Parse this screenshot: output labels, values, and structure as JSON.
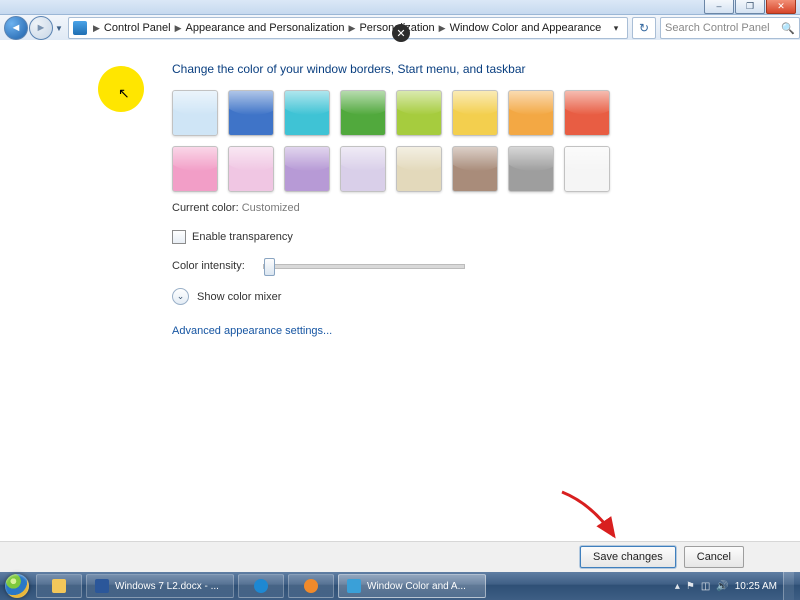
{
  "window": {
    "min": "–",
    "max": "❐",
    "close": "✕"
  },
  "overlay": {
    "close_badge": "✕"
  },
  "nav": {
    "crumbs": [
      "Control Panel",
      "Appearance and Personalization",
      "Personalization",
      "Window Color and Appearance"
    ],
    "search_placeholder": "Search Control Panel"
  },
  "page": {
    "heading": "Change the color of your window borders, Start menu, and taskbar",
    "current_color_label": "Current color:",
    "current_color_value": "Customized",
    "transparency_label": "Enable transparency",
    "intensity_label": "Color intensity:",
    "mixer_label": "Show color mixer",
    "advanced_link": "Advanced appearance settings...",
    "save": "Save changes",
    "cancel": "Cancel",
    "swatches_row1": [
      "#cfe5f6",
      "#3f74c8",
      "#3fc3d5",
      "#51a93d",
      "#a6cc3e",
      "#f3cf4e",
      "#f3a844",
      "#e85d43"
    ],
    "swatches_row2": [
      "#f29ec7",
      "#f0c6e3",
      "#b79ad6",
      "#d9cfe9",
      "#e3d9bb",
      "#a98c7a",
      "#9e9e9e",
      "#f5f5f5"
    ]
  },
  "taskbar": {
    "items": [
      {
        "label": "Windows 7 L2.docx - ...",
        "icon": "#2b579a"
      },
      {
        "label": "Window Color and A...",
        "icon": "#3aa0d8"
      }
    ],
    "clock": "10:25 AM"
  }
}
